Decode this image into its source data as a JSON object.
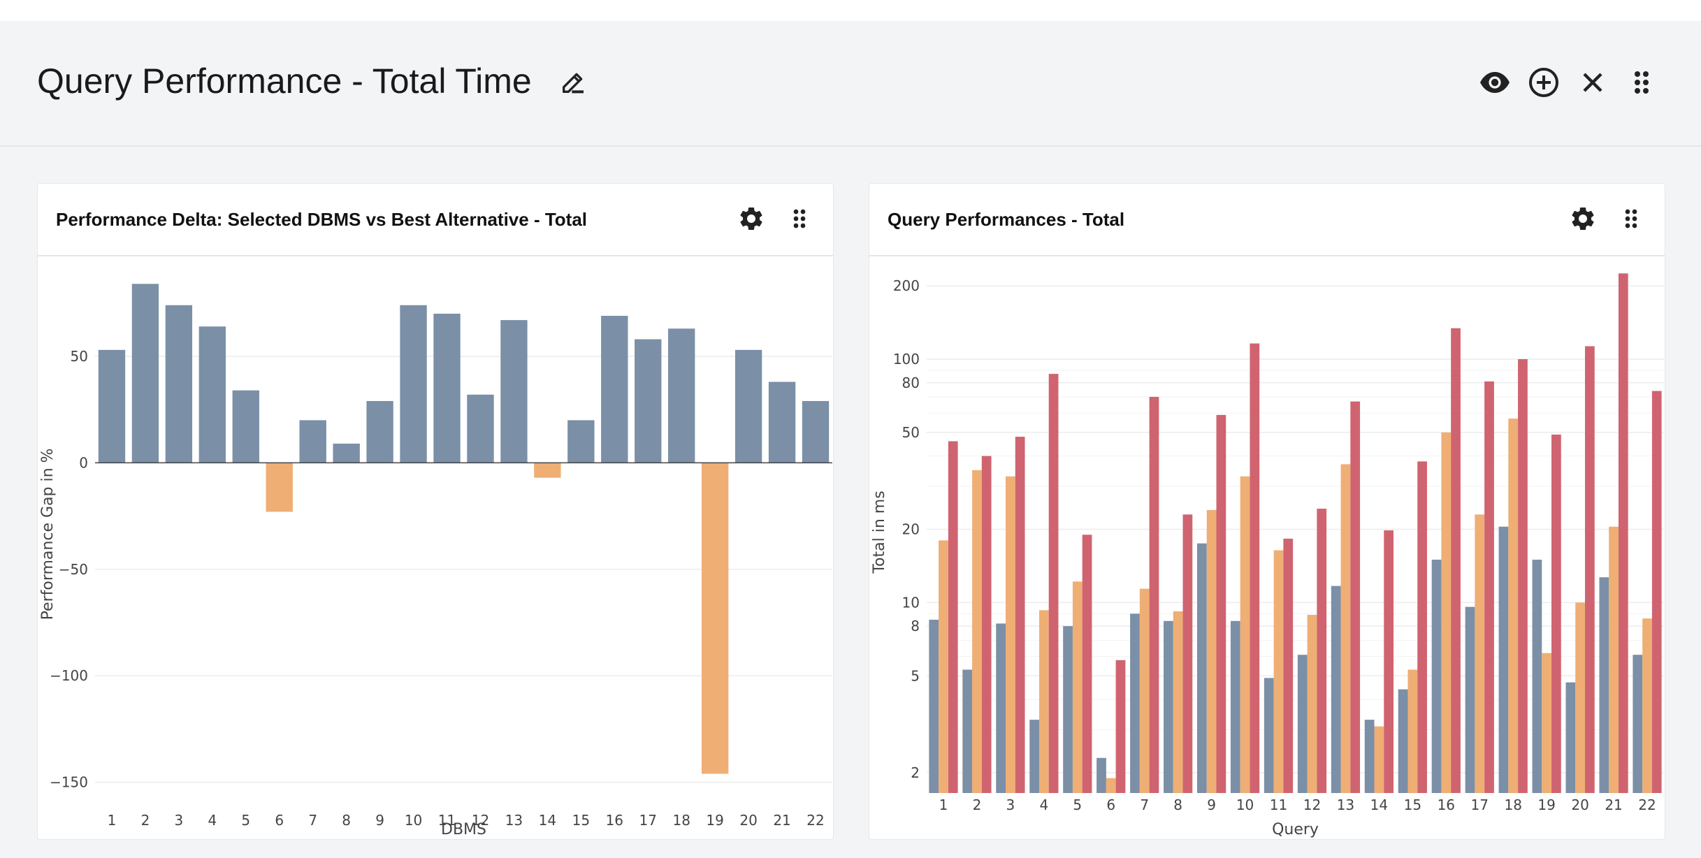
{
  "page": {
    "title": "Query Performance - Total Time"
  },
  "header_icons": [
    "edit-icon",
    "eye-icon",
    "add-circle-icon",
    "close-icon",
    "drag-handle-icon"
  ],
  "cards": [
    {
      "title": "Performance Delta: Selected DBMS vs Best Alternative - Total",
      "icons": [
        "gear-icon",
        "drag-handle-icon"
      ]
    },
    {
      "title": "Query Performances - Total",
      "icons": [
        "gear-icon",
        "drag-handle-icon"
      ]
    }
  ],
  "colors": {
    "slate": "#7b8fa7",
    "orange": "#efae74",
    "red": "#cf6470",
    "grid": "#ececec",
    "axis_text": "#444444"
  },
  "chart_data": [
    {
      "type": "bar",
      "title": "",
      "xlabel": "DBMS",
      "ylabel": "Performance Gap in %",
      "categories": [
        "1",
        "2",
        "3",
        "4",
        "5",
        "6",
        "7",
        "8",
        "9",
        "10",
        "11",
        "12",
        "13",
        "14",
        "15",
        "16",
        "17",
        "18",
        "19",
        "20",
        "21",
        "22"
      ],
      "values": [
        53,
        84,
        74,
        64,
        34,
        -23,
        20,
        9,
        29,
        74,
        70,
        32,
        67,
        -7,
        20,
        69,
        58,
        63,
        -146,
        53,
        38,
        29
      ],
      "yticks": [
        -150,
        -100,
        -50,
        0,
        50
      ],
      "ytick_labels": [
        "−150",
        "−100",
        "−50",
        "0",
        "50"
      ],
      "ylim": [
        -157,
        90
      ],
      "grid": true,
      "legend": "none"
    },
    {
      "type": "bar",
      "title": "",
      "xlabel": "Query",
      "ylabel": "Total in ms",
      "yscale": "log",
      "categories": [
        "1",
        "2",
        "3",
        "4",
        "5",
        "6",
        "7",
        "8",
        "9",
        "10",
        "11",
        "12",
        "13",
        "14",
        "15",
        "16",
        "17",
        "18",
        "19",
        "20",
        "21",
        "22"
      ],
      "series": [
        {
          "color": "#7b8fa7",
          "values": [
            8.5,
            5.3,
            8.2,
            3.3,
            8.0,
            2.3,
            9.0,
            8.4,
            17.5,
            8.4,
            4.9,
            6.1,
            11.7,
            3.3,
            4.4,
            15.0,
            9.6,
            20.5,
            15.0,
            4.7,
            12.7,
            6.1
          ]
        },
        {
          "color": "#efae74",
          "values": [
            18.0,
            35.0,
            33.0,
            9.3,
            12.2,
            1.9,
            11.4,
            9.2,
            24.0,
            33.0,
            16.4,
            8.9,
            37.0,
            3.1,
            5.3,
            50.0,
            23.0,
            57.0,
            6.2,
            10.0,
            20.5,
            8.6
          ]
        },
        {
          "color": "#cf6470",
          "values": [
            46,
            40,
            48,
            87,
            19,
            5.8,
            70,
            23,
            59,
            116,
            18.3,
            24.3,
            67,
            19.8,
            38,
            134,
            81,
            100,
            49,
            113,
            225,
            74
          ]
        }
      ],
      "yticks": [
        2,
        5,
        8,
        10,
        20,
        50,
        80,
        100,
        200
      ],
      "minor_grid": [
        3,
        4,
        6,
        7,
        9,
        30,
        40,
        60,
        70,
        90
      ],
      "ylim": [
        1.65,
        230
      ],
      "grid": true,
      "legend": "none"
    }
  ]
}
